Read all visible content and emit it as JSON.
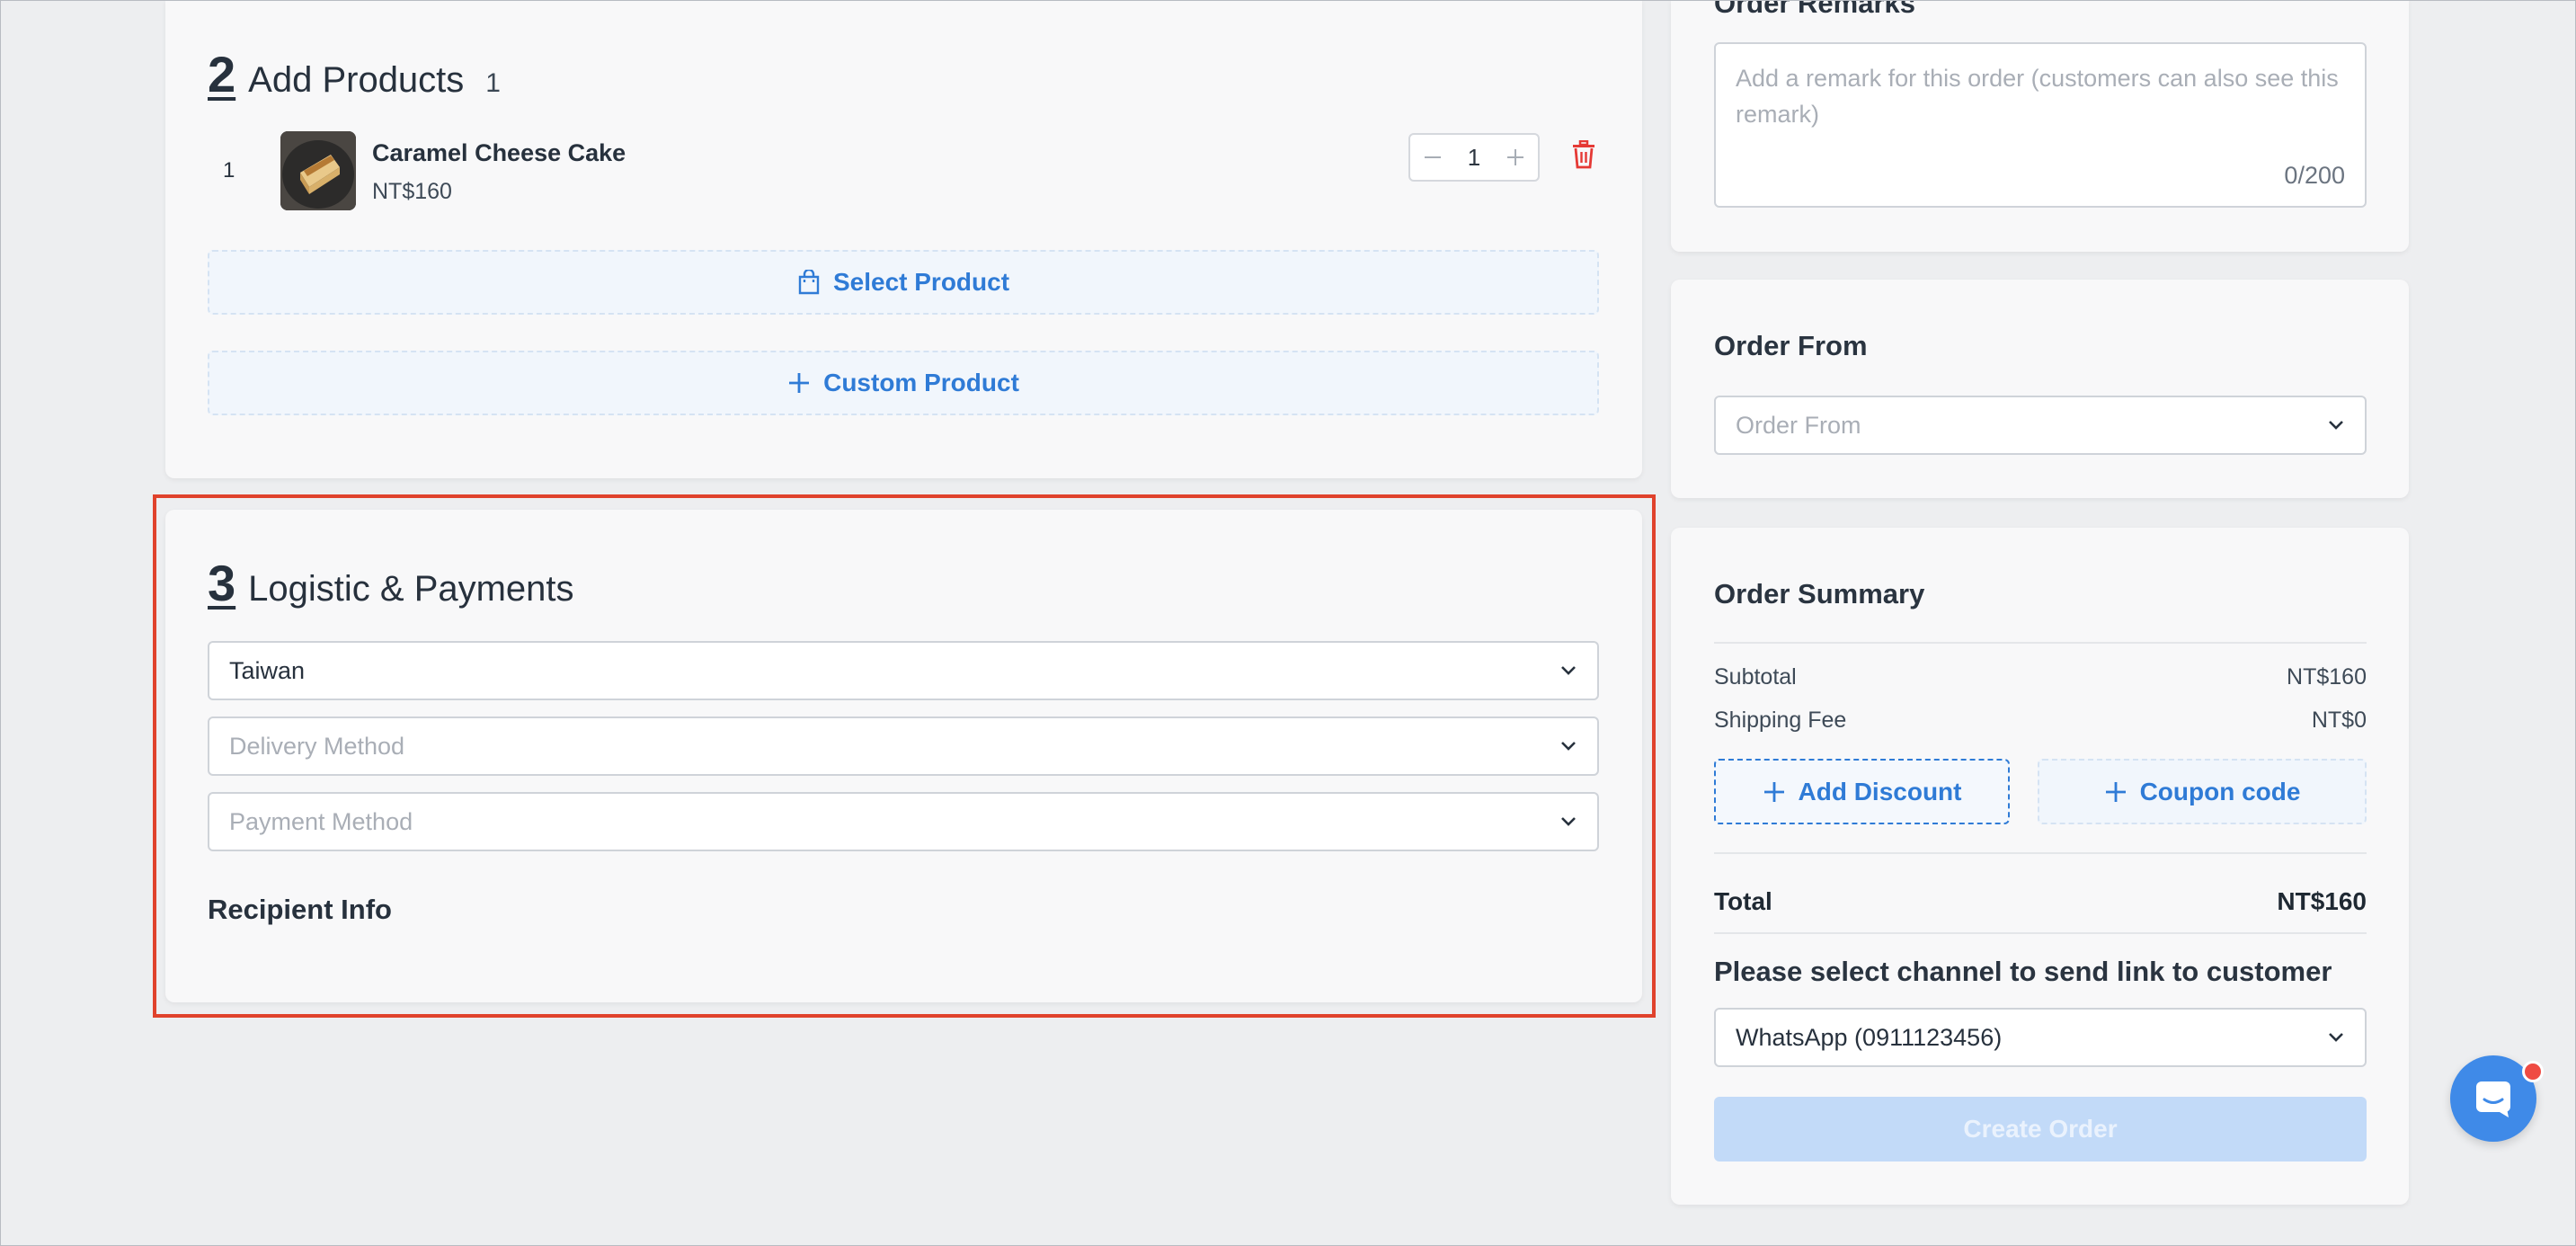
{
  "products": {
    "section_number": "2",
    "title": "Add Products",
    "count": "1",
    "items": [
      {
        "index": "1",
        "name": "Caramel Cheese Cake",
        "price": "NT$160",
        "quantity": "1"
      }
    ],
    "select_product_label": "Select Product",
    "custom_product_label": "Custom Product"
  },
  "logistics": {
    "section_number": "3",
    "title": "Logistic & Payments",
    "country_value": "Taiwan",
    "delivery_placeholder": "Delivery Method",
    "payment_placeholder": "Payment Method",
    "recipient_heading": "Recipient Info"
  },
  "remarks": {
    "label": "Order Remarks",
    "placeholder": "Add a remark for this order (customers can also see this remark)",
    "counter": "0/200"
  },
  "order_from": {
    "label": "Order From",
    "placeholder": "Order From"
  },
  "summary": {
    "title": "Order Summary",
    "subtotal_label": "Subtotal",
    "subtotal_value": "NT$160",
    "shipping_label": "Shipping Fee",
    "shipping_value": "NT$0",
    "add_discount_label": "Add Discount",
    "coupon_label": "Coupon code",
    "total_label": "Total",
    "total_value": "NT$160",
    "channel_prompt": "Please select channel to send link to customer",
    "channel_value": "WhatsApp (0911123456)",
    "create_label": "Create Order"
  },
  "colors": {
    "accent": "#2f7bd6",
    "highlight": "#e0422c",
    "delete": "#e53935",
    "create_disabled": "#c2daf8"
  },
  "icons": [
    "minus-icon",
    "plus-icon",
    "trash-icon",
    "shopping-bag-icon",
    "chevron-down-icon",
    "chat-icon"
  ]
}
